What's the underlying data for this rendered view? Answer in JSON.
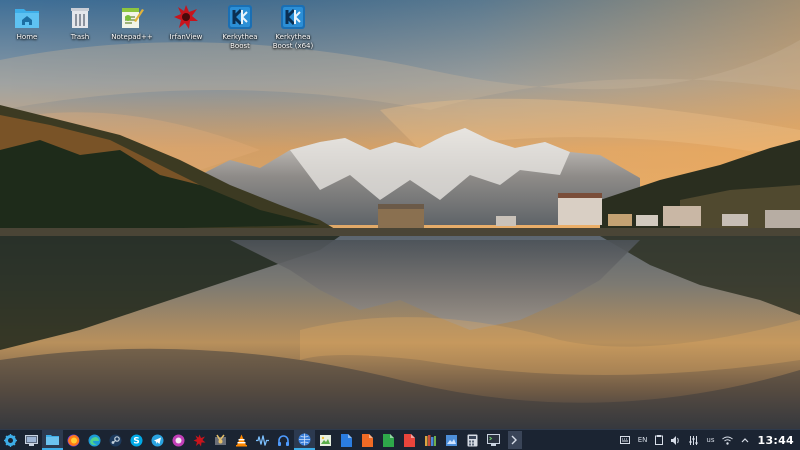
{
  "desktop": {
    "icons": [
      {
        "label": "Home",
        "icon": "home-folder-icon"
      },
      {
        "label": "Trash",
        "icon": "trash-icon"
      },
      {
        "label": "Notepad++",
        "icon": "notepad-plus-plus-icon"
      },
      {
        "label": "IrfanView",
        "icon": "irfanview-icon"
      },
      {
        "label": "Kerkythea Boost",
        "icon": "kerkythea-icon"
      },
      {
        "label": "Kerkythea Boost (x64)",
        "icon": "kerkythea-x64-icon"
      }
    ]
  },
  "taskbar": {
    "apps": [
      "application-launcher-icon",
      "show-desktop-icon",
      "file-manager-icon",
      "firefox-icon",
      "edge-icon",
      "steam-icon",
      "skype-icon",
      "telegram-icon",
      "app-circle-icon",
      "irfanview-icon",
      "media-tool-icon",
      "vlc-icon",
      "audio-editor-icon",
      "headphones-icon",
      "browser-icon",
      "photo-viewer-icon",
      "word-document-icon",
      "presentation-icon",
      "spreadsheet-icon",
      "document-icon",
      "library-icon",
      "image-editor-icon",
      "calculator-icon",
      "terminal-monitor-icon",
      "terminal-icon"
    ],
    "tray": {
      "language": "EN",
      "keyboard_layout": "us",
      "clock": "13:44"
    }
  },
  "colors": {
    "taskbar_bg": "#1b2432",
    "accent": "#3daee9"
  }
}
